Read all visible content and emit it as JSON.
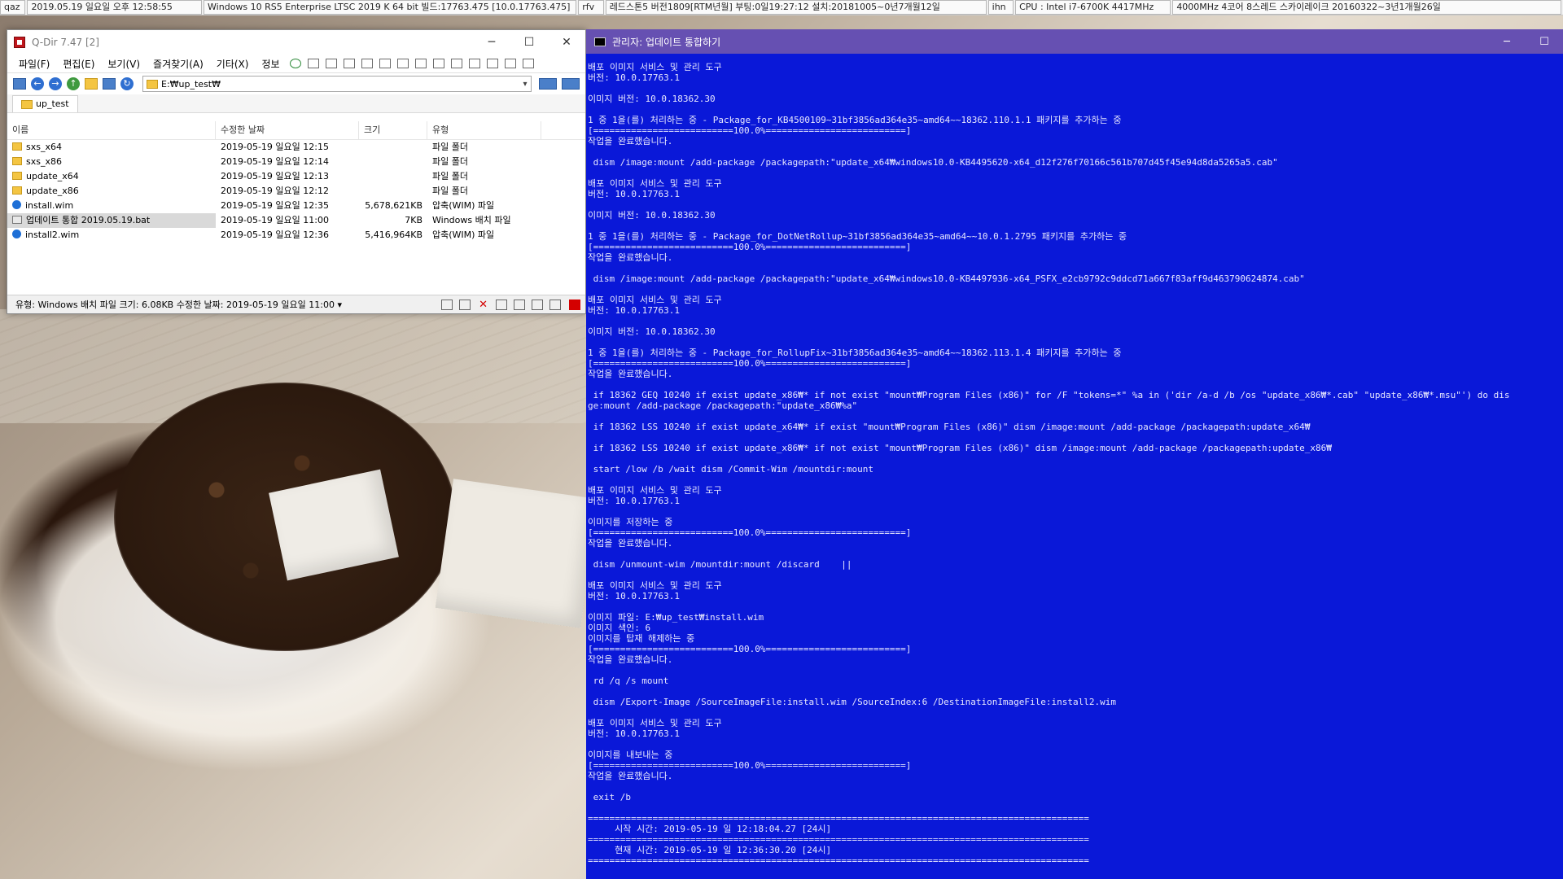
{
  "topbar": {
    "segments": [
      "qaz",
      "2019.05.19 일요일 오후 12:58:55",
      "Windows 10 RS5 Enterprise LTSC 2019 K 64 bit 빌드:17763.475 [10.0.17763.475]",
      "rfv",
      "레드스톤5 버전1809[RTM년월] 부팅:0일19:27:12 설치:20181005~0년7개월12일",
      "ihn",
      "CPU : Intel i7-6700K 4417MHz",
      "4000MHz 4코어 8스레드 스카이레이크 20160322~3년1개월26일"
    ]
  },
  "qdir": {
    "title": "Q-Dir 7.47 [2]",
    "window_buttons": {
      "minimize": "─",
      "maximize": "☐",
      "close": "✕"
    },
    "menu": [
      "파일(F)",
      "편집(E)",
      "보기(V)",
      "즐겨찾기(A)",
      "기타(X)",
      "정보"
    ],
    "address": "E:₩up_test₩",
    "tab": "up_test",
    "columns": {
      "name": "이름",
      "date": "수정한 날짜",
      "size": "크기",
      "type": "유형"
    },
    "files": [
      {
        "name": "sxs_x64",
        "date": "2019-05-19 일요일 12:15",
        "size": "",
        "type": "파일 폴더",
        "icon": "folder-icon",
        "selected": false
      },
      {
        "name": "sxs_x86",
        "date": "2019-05-19 일요일 12:14",
        "size": "",
        "type": "파일 폴더",
        "icon": "folder-icon",
        "selected": false
      },
      {
        "name": "update_x64",
        "date": "2019-05-19 일요일 12:13",
        "size": "",
        "type": "파일 폴더",
        "icon": "folder-icon",
        "selected": false
      },
      {
        "name": "update_x86",
        "date": "2019-05-19 일요일 12:12",
        "size": "",
        "type": "파일 폴더",
        "icon": "folder-icon",
        "selected": false
      },
      {
        "name": "install.wim",
        "date": "2019-05-19 일요일 12:35",
        "size": "5,678,621KB",
        "type": "압축(WIM) 파일",
        "icon": "wim-file-icon",
        "selected": false
      },
      {
        "name": "업데이트 통합 2019.05.19.bat",
        "date": "2019-05-19 일요일 11:00",
        "size": "7KB",
        "type": "Windows 배치 파일",
        "icon": "batch-file-icon",
        "selected": true
      },
      {
        "name": "install2.wim",
        "date": "2019-05-19 일요일 12:36",
        "size": "5,416,964KB",
        "type": "압축(WIM) 파일",
        "icon": "wim-file-icon",
        "selected": false
      }
    ],
    "status": "유형: Windows 배치 파일 크기: 6.08KB 수정한 날짜: 2019-05-19 일요일 11:00 ▾"
  },
  "console": {
    "title": "관리자:  업데이트 통합하기",
    "window_buttons": {
      "minimize": "─",
      "maximize": "☐"
    },
    "lines": [
      "배포 이미지 서비스 및 관리 도구",
      "버전: 10.0.17763.1",
      "",
      "이미지 버전: 10.0.18362.30",
      "",
      "1 중 1을(를) 처리하는 중 - Package_for_KB4500109~31bf3856ad364e35~amd64~~18362.110.1.1 패키지를 추가하는 중",
      "[==========================100.0%==========================]",
      "작업을 완료했습니다.",
      "",
      " dism /image:mount /add-package /packagepath:\"update_x64₩windows10.0-KB4495620-x64_d12f276f70166c561b707d45f45e94d8da5265a5.cab\"",
      "",
      "배포 이미지 서비스 및 관리 도구",
      "버전: 10.0.17763.1",
      "",
      "이미지 버전: 10.0.18362.30",
      "",
      "1 중 1을(를) 처리하는 중 - Package_for_DotNetRollup~31bf3856ad364e35~amd64~~10.0.1.2795 패키지를 추가하는 중",
      "[==========================100.0%==========================]",
      "작업을 완료했습니다.",
      "",
      " dism /image:mount /add-package /packagepath:\"update_x64₩windows10.0-KB4497936-x64_PSFX_e2cb9792c9ddcd71a667f83aff9d463790624874.cab\"",
      "",
      "배포 이미지 서비스 및 관리 도구",
      "버전: 10.0.17763.1",
      "",
      "이미지 버전: 10.0.18362.30",
      "",
      "1 중 1을(를) 처리하는 중 - Package_for_RollupFix~31bf3856ad364e35~amd64~~18362.113.1.4 패키지를 추가하는 중",
      "[==========================100.0%==========================]",
      "작업을 완료했습니다.",
      "",
      " if 18362 GEQ 10240 if exist update_x86₩* if not exist \"mount₩Program Files (x86)\" for /F \"tokens=*\" %a in ('dir /a-d /b /os \"update_x86₩*.cab\" \"update_x86₩*.msu\"') do dis",
      "ge:mount /add-package /packagepath:\"update_x86₩%a\"",
      "",
      " if 18362 LSS 10240 if exist update_x64₩* if exist \"mount₩Program Files (x86)\" dism /image:mount /add-package /packagepath:update_x64₩",
      "",
      " if 18362 LSS 10240 if exist update_x86₩* if not exist \"mount₩Program Files (x86)\" dism /image:mount /add-package /packagepath:update_x86₩",
      "",
      " start /low /b /wait dism /Commit-Wim /mountdir:mount",
      "",
      "배포 이미지 서비스 및 관리 도구",
      "버전: 10.0.17763.1",
      "",
      "이미지를 저장하는 중",
      "[==========================100.0%==========================]",
      "작업을 완료했습니다.",
      "",
      " dism /unmount-wim /mountdir:mount /discard    ||",
      "",
      "배포 이미지 서비스 및 관리 도구",
      "버전: 10.0.17763.1",
      "",
      "이미지 파일: E:₩up_test₩install.wim",
      "이미지 색인: 6",
      "이미지를 탑재 해제하는 중",
      "[==========================100.0%==========================]",
      "작업을 완료했습니다.",
      "",
      " rd /q /s mount",
      "",
      " dism /Export-Image /SourceImageFile:install.wim /SourceIndex:6 /DestinationImageFile:install2.wim",
      "",
      "배포 이미지 서비스 및 관리 도구",
      "버전: 10.0.17763.1",
      "",
      "이미지를 내보내는 중",
      "[==========================100.0%==========================]",
      "작업을 완료했습니다.",
      "",
      " exit /b",
      "",
      "=============================================================================================",
      "     시작 시간: 2019-05-19 일 12:18:04.27 [24시]",
      "=============================================================================================",
      "     현재 시간: 2019-05-19 일 12:36:30.20 [24시]",
      "============================================================================================="
    ]
  }
}
